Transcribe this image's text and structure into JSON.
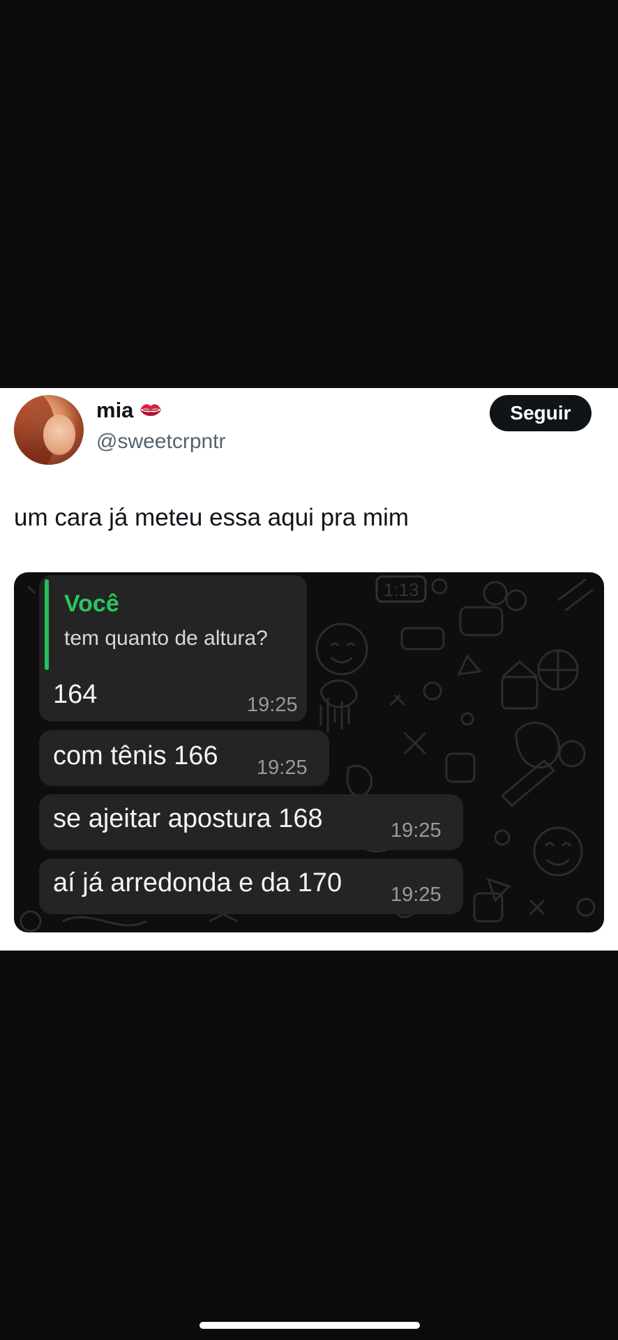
{
  "post": {
    "display_name": "mia",
    "handle": "@sweetcrpntr",
    "follow_label": "Seguir",
    "text": "um cara já meteu essa aqui pra mim",
    "emoji_icon": "kiss-mark-icon"
  },
  "chat": {
    "quote": {
      "author": "Você",
      "text": "tem quanto de altura?"
    },
    "messages": [
      {
        "text": "164",
        "time": "19:25"
      },
      {
        "text": "com tênis 166",
        "time": "19:25"
      },
      {
        "text": "se ajeitar apostura 168",
        "time": "19:25"
      },
      {
        "text": "aí já arredonda e da 170",
        "time": "19:25"
      }
    ],
    "background_clock": "1:13",
    "colors": {
      "quote_accent": "#2bc65f",
      "bubble": "#242424",
      "background": "#0e0e0e"
    }
  },
  "colors": {
    "follow_button": "#0f1419",
    "handle_text": "#536471",
    "page_background": "#0b0b0c"
  }
}
